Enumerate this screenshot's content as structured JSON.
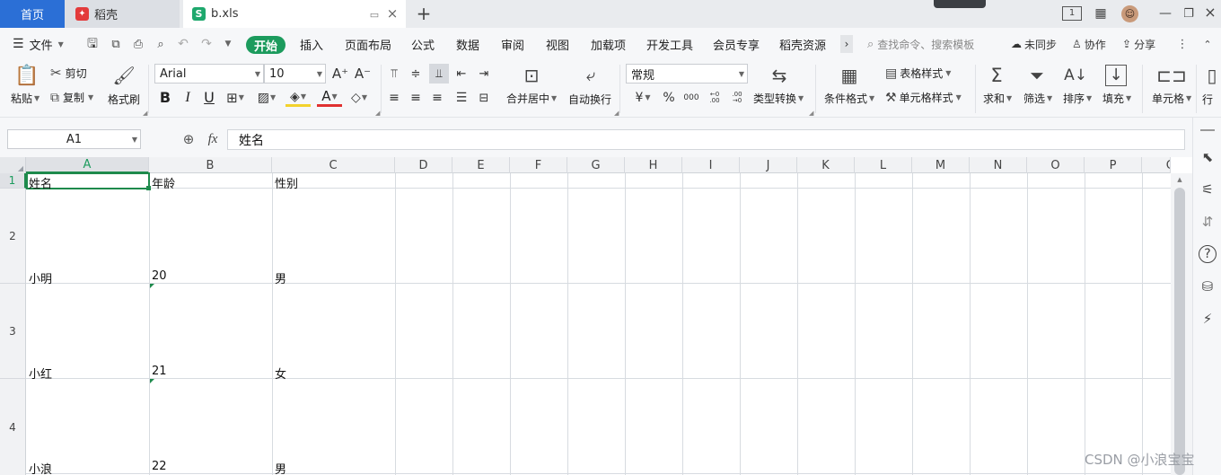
{
  "tabs": {
    "home": "首页",
    "docer": "稻壳",
    "file": "b.xls"
  },
  "menu": {
    "file": "文件",
    "start": "开始",
    "items": [
      "插入",
      "页面布局",
      "公式",
      "数据",
      "审阅",
      "视图",
      "加载项",
      "开发工具",
      "会员专享",
      "稻壳资源"
    ],
    "search_placeholder": "查找命令、搜索模板",
    "sync": "未同步",
    "collab": "协作",
    "share": "分享"
  },
  "ribbon": {
    "paste": "粘贴",
    "cut": "剪切",
    "copy": "复制",
    "format_painter": "格式刷",
    "font_name": "Arial",
    "font_size": "10",
    "merge_center": "合并居中",
    "wrap_text": "自动换行",
    "number_format": "常规",
    "currency_symbol": "¥",
    "percent_symbol": "%",
    "thousands": "000",
    "inc_decimal": "←0 .00",
    "dec_decimal": ".00 →0",
    "type_convert": "类型转换",
    "cond_format": "条件格式",
    "table_style": "表格样式",
    "cell_style": "单元格样式",
    "sum": "求和",
    "filter": "筛选",
    "sort": "排序",
    "fill": "填充",
    "cell": "单元格",
    "row_col": "行"
  },
  "formula_bar": {
    "name_box": "A1",
    "fx": "fx",
    "content": "姓名"
  },
  "columns": [
    "A",
    "B",
    "C",
    "D",
    "E",
    "F",
    "G",
    "H",
    "I",
    "J",
    "K",
    "L",
    "M",
    "N",
    "O",
    "P",
    "Q"
  ],
  "rows": [
    {
      "num": "1",
      "cells": [
        "姓名",
        "年龄",
        "性别"
      ]
    },
    {
      "num": "2",
      "cells": [
        "小明",
        "20",
        "男"
      ]
    },
    {
      "num": "3",
      "cells": [
        "小红",
        "21",
        "女"
      ]
    },
    {
      "num": "4",
      "cells": [
        "小浪",
        "22",
        "男"
      ]
    }
  ],
  "watermark": "CSDN @小浪宝宝",
  "colors": {
    "accent_green": "#1c9b5d",
    "home_tab": "#2b6fd6",
    "selection": "#1e8a4c"
  }
}
